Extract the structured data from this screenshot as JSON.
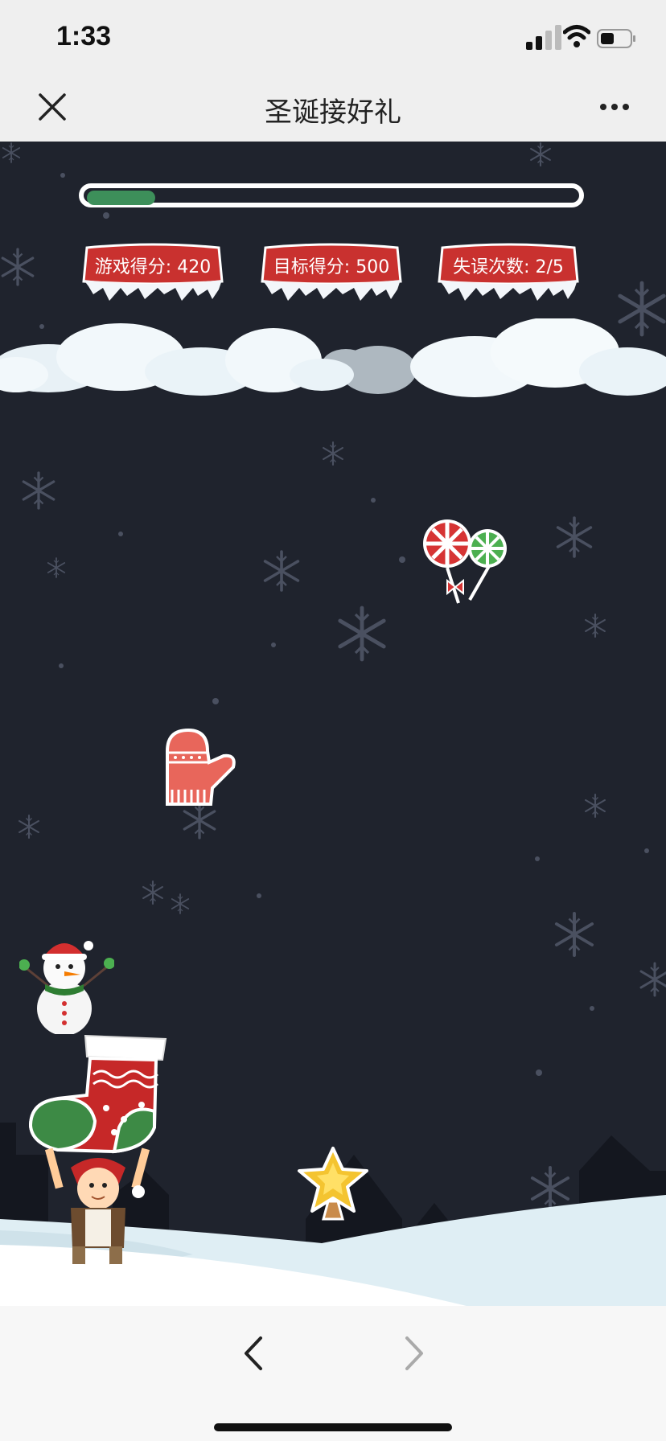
{
  "status_bar": {
    "time": "1:33"
  },
  "nav": {
    "title": "圣诞接好礼"
  },
  "game": {
    "progress_fraction": 0.14,
    "score_label": "游戏得分: 420",
    "target_label": "目标得分: 500",
    "miss_label": "失误次数: 2/5",
    "falling_items": [
      "lollipops",
      "mitten",
      "star"
    ],
    "characters": [
      "snowman",
      "elf-with-stocking"
    ]
  },
  "colors": {
    "stage_bg": "#1f232d",
    "badge_red": "#c9312f",
    "progress_green": "#3d8f5a"
  }
}
